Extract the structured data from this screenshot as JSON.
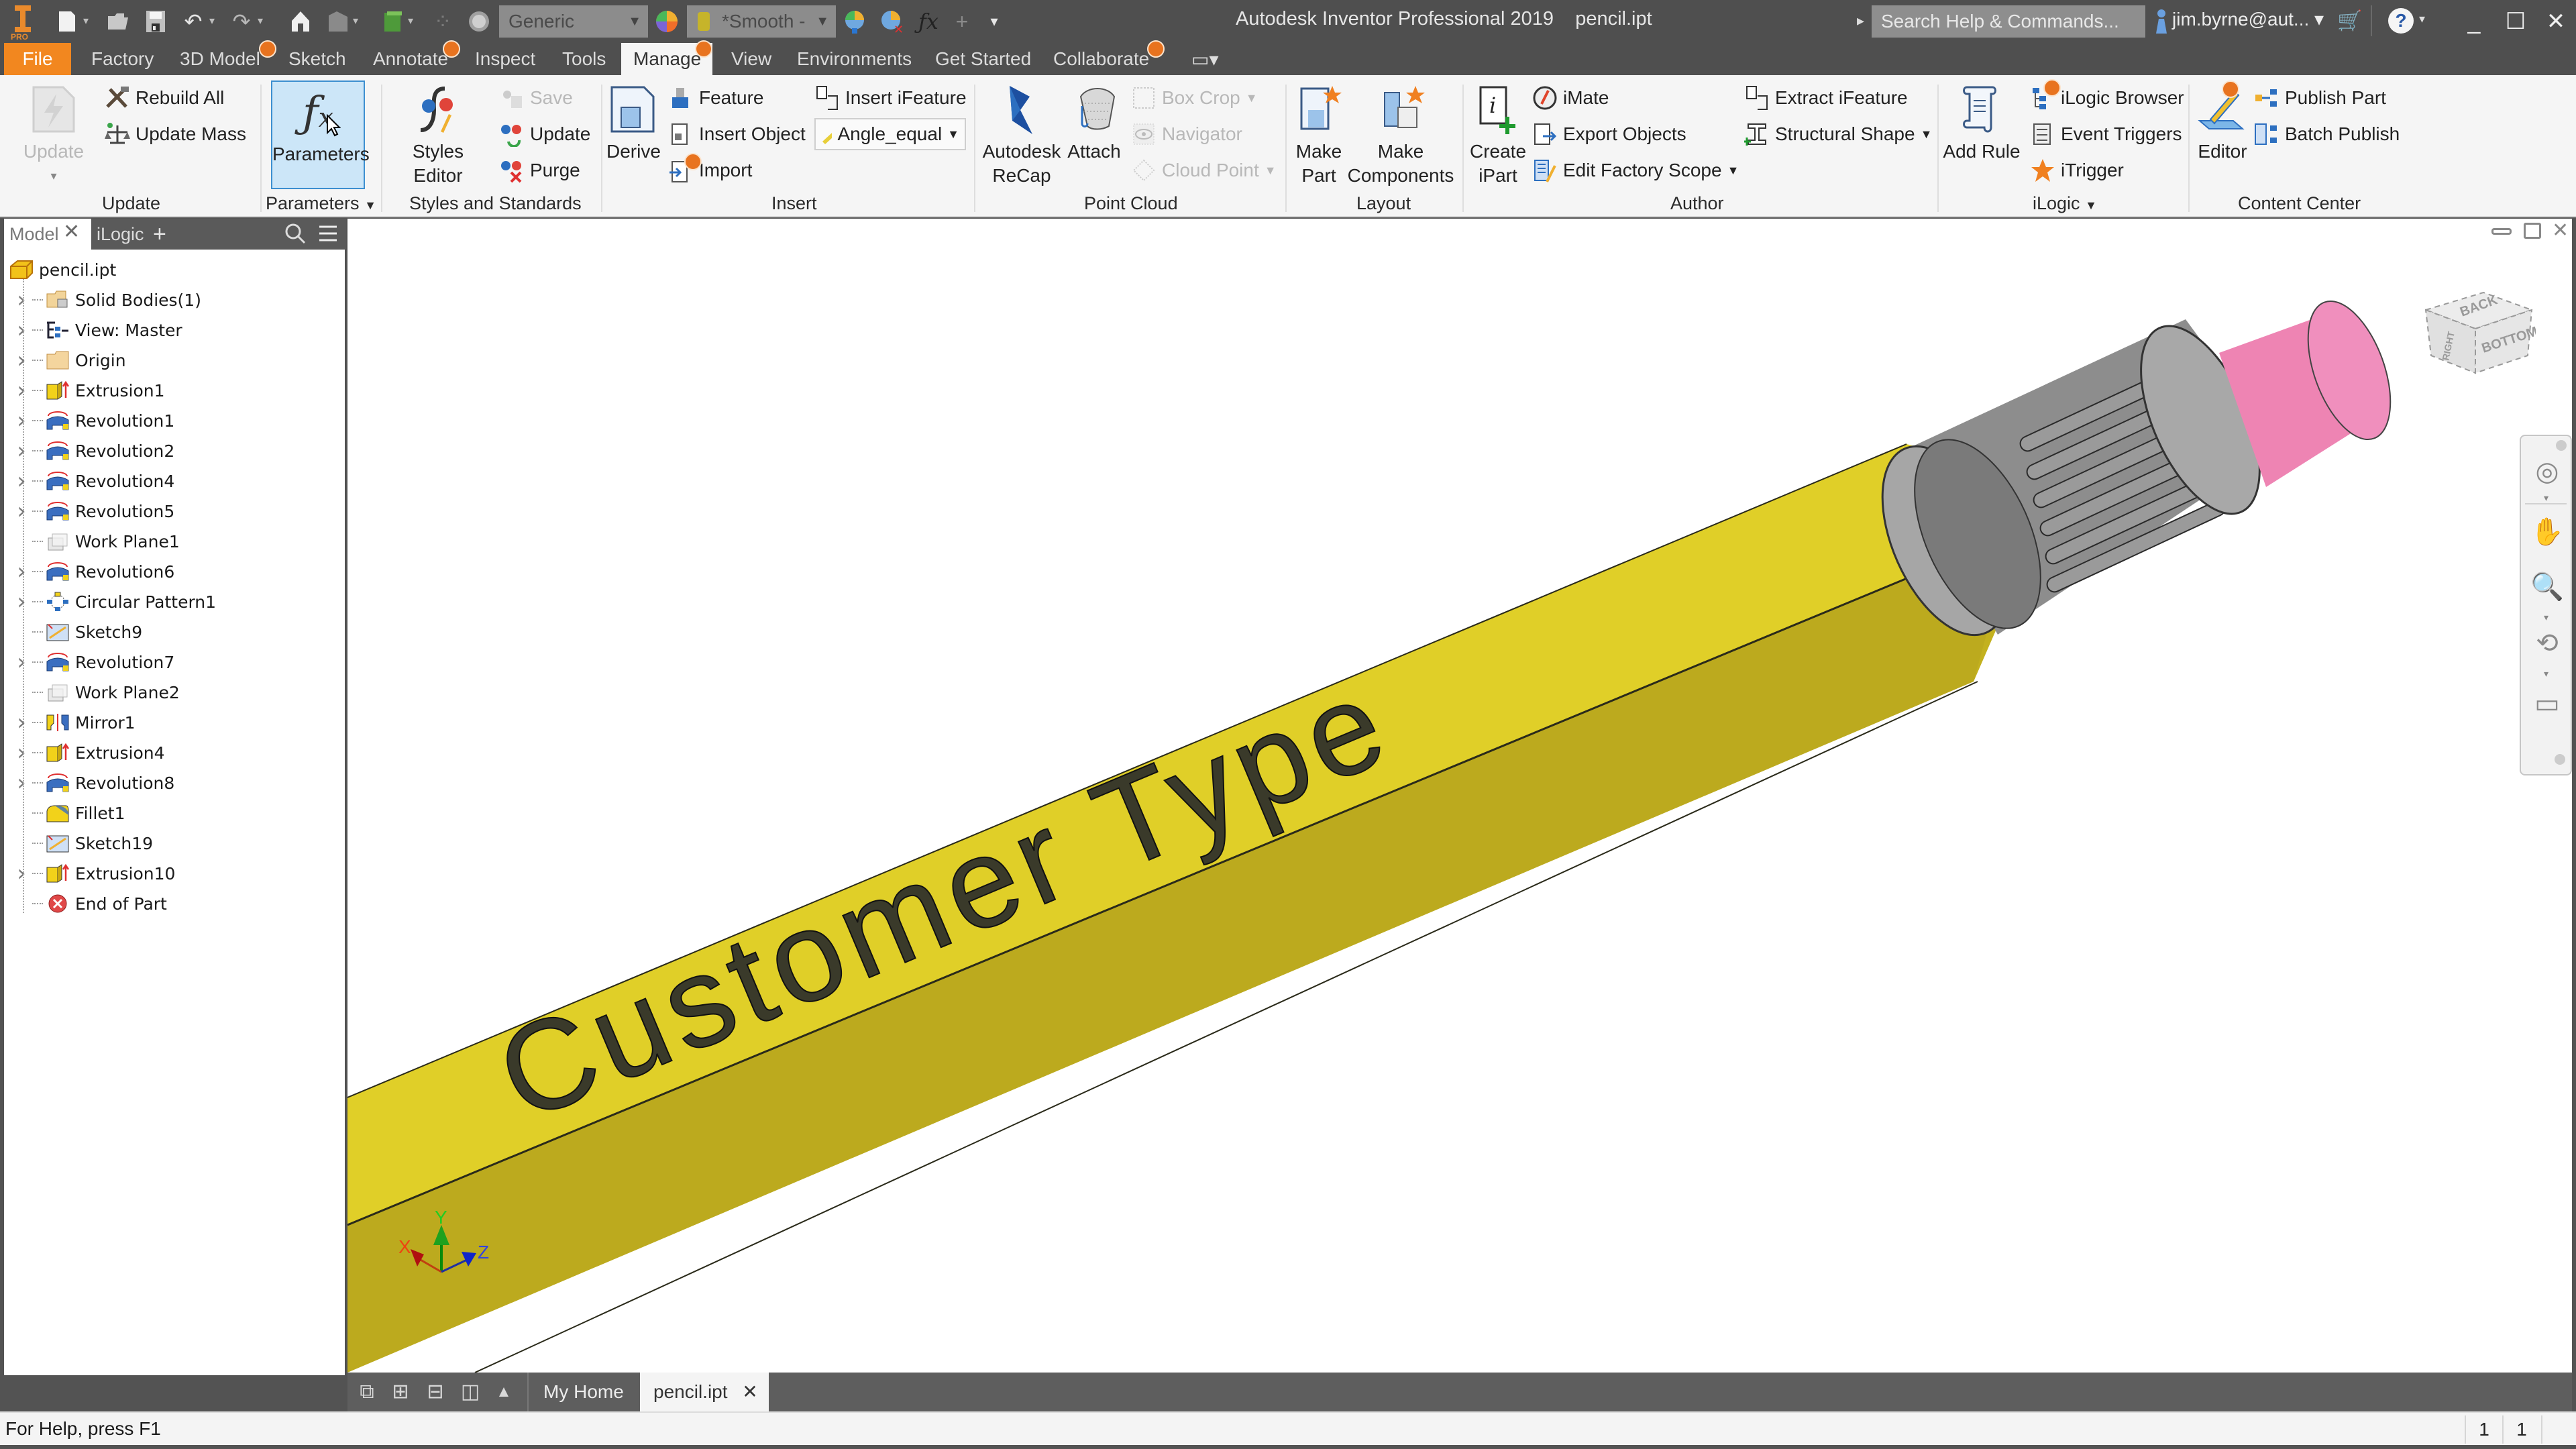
{
  "titlebar": {
    "app_title": "Autodesk Inventor Professional 2019",
    "document_name": "pencil.ipt",
    "app_logo_badge": "PRO",
    "material_select": "Generic",
    "appearance_select": "*Smooth -",
    "search_placeholder": "Search Help & Commands...",
    "user": "jim.byrne@aut...",
    "quick_access_icons": [
      "new-icon",
      "open-icon",
      "save-icon",
      "undo-icon",
      "redo-icon",
      "home-icon",
      "update-icon",
      "select-icon",
      "ipart-icon",
      "color-wheel-icon"
    ],
    "window_controls": {
      "minimize": "_",
      "maximize": "☐",
      "close": "✕"
    }
  },
  "ribbon_tabs": [
    {
      "label": "File",
      "type": "file"
    },
    {
      "label": "Factory"
    },
    {
      "label": "3D Model",
      "badge": true
    },
    {
      "label": "Sketch"
    },
    {
      "label": "Annotate",
      "badge": true
    },
    {
      "label": "Inspect"
    },
    {
      "label": "Tools"
    },
    {
      "label": "Manage",
      "active": true,
      "badge": true
    },
    {
      "label": "View"
    },
    {
      "label": "Environments"
    },
    {
      "label": "Get Started"
    },
    {
      "label": "Collaborate",
      "badge": true
    }
  ],
  "ribbon": {
    "groups": {
      "update": {
        "label": "Update",
        "update": "Update",
        "rebuild_all": "Rebuild All",
        "update_mass": "Update Mass"
      },
      "parameters": {
        "label": "Parameters",
        "parameters": "Parameters"
      },
      "styles": {
        "label": "Styles and Standards",
        "styles_editor": "Styles Editor",
        "save": "Save",
        "update": "Update",
        "purge": "Purge"
      },
      "insert": {
        "label": "Insert",
        "derive": "Derive",
        "feature": "Feature",
        "insert_object": "Insert Object",
        "import": "Import",
        "insert_ifeature": "Insert iFeature",
        "angle_select": "Angle_equal"
      },
      "point_cloud": {
        "label": "Point Cloud",
        "autodesk_recap_1": "Autodesk",
        "autodesk_recap_2": "ReCap",
        "attach": "Attach",
        "box_crop": "Box Crop",
        "navigator": "Navigator",
        "cloud_point": "Cloud Point"
      },
      "layout": {
        "label": "Layout",
        "make_part_1": "Make",
        "make_part_2": "Part",
        "make_components_1": "Make",
        "make_components_2": "Components"
      },
      "author": {
        "label": "Author",
        "create_ipart_1": "Create",
        "create_ipart_2": "iPart",
        "imate": "iMate",
        "export_objects": "Export Objects",
        "edit_factory_scope": "Edit Factory Scope",
        "extract_ifeature": "Extract iFeature",
        "structural_shape": "Structural Shape"
      },
      "ilogic": {
        "label": "iLogic",
        "add_rule": "Add Rule",
        "ilogic_browser": "iLogic Browser",
        "event_triggers": "Event Triggers",
        "itrigger": "iTrigger"
      },
      "content_center": {
        "label": "Content Center",
        "editor": "Editor",
        "publish_part": "Publish Part",
        "batch_publish": "Batch Publish"
      }
    }
  },
  "browser": {
    "tabs": [
      {
        "label": "Model",
        "active": true
      },
      {
        "label": "iLogic"
      }
    ],
    "add_tab": "+",
    "root": "pencil.ipt",
    "items": [
      {
        "label": "Solid Bodies(1)",
        "icon": "solid-bodies-icon",
        "expandable": true
      },
      {
        "label": "View: Master",
        "icon": "view-rep-icon",
        "expandable": true
      },
      {
        "label": "Origin",
        "icon": "folder-icon",
        "expandable": true
      },
      {
        "label": "Extrusion1",
        "icon": "extrusion-icon",
        "expandable": true
      },
      {
        "label": "Revolution1",
        "icon": "revolution-icon",
        "expandable": true
      },
      {
        "label": "Revolution2",
        "icon": "revolution-icon",
        "expandable": true
      },
      {
        "label": "Revolution4",
        "icon": "revolution-icon",
        "expandable": true
      },
      {
        "label": "Revolution5",
        "icon": "revolution-icon",
        "expandable": true
      },
      {
        "label": "Work Plane1",
        "icon": "work-plane-icon",
        "expandable": false
      },
      {
        "label": "Revolution6",
        "icon": "revolution-icon",
        "expandable": true
      },
      {
        "label": "Circular Pattern1",
        "icon": "circular-pattern-icon",
        "expandable": true
      },
      {
        "label": "Sketch9",
        "icon": "sketch-icon",
        "expandable": false
      },
      {
        "label": "Revolution7",
        "icon": "revolution-icon",
        "expandable": true
      },
      {
        "label": "Work Plane2",
        "icon": "work-plane-icon",
        "expandable": false
      },
      {
        "label": "Mirror1",
        "icon": "mirror-icon",
        "expandable": true
      },
      {
        "label": "Extrusion4",
        "icon": "extrusion-icon",
        "expandable": true
      },
      {
        "label": "Revolution8",
        "icon": "revolution-icon",
        "expandable": true
      },
      {
        "label": "Fillet1",
        "icon": "fillet-icon",
        "expandable": false
      },
      {
        "label": "Sketch19",
        "icon": "sketch-icon",
        "expandable": false
      },
      {
        "label": "Extrusion10",
        "icon": "extrusion-icon",
        "expandable": true
      },
      {
        "label": "End of Part",
        "icon": "end-of-part-icon",
        "expandable": false
      }
    ]
  },
  "viewport": {
    "engraved_text": "Customer Type",
    "viewcube_faces": {
      "top": "BACK",
      "front": "BOTTOM",
      "side": "RIGHT"
    },
    "triad": {
      "x": "X",
      "y": "Y",
      "z": "Z"
    },
    "colors": {
      "pencil_body_light": "#e3d22a",
      "pencil_body_dark": "#c2b021",
      "ferrule": "#8e8e8e",
      "eraser": "#f08bb8"
    }
  },
  "doc_tabs": {
    "my_home": "My Home",
    "active_doc": "pencil.ipt",
    "close": "✕"
  },
  "statusbar": {
    "help_text": "For Help, press F1",
    "count_1": "1",
    "count_2": "1"
  },
  "colors": {
    "accent_orange": "#f2871f",
    "badge_orange": "#e8731f",
    "chrome_dark": "#4f4f4f",
    "selection_blue": "#cce6f8"
  }
}
